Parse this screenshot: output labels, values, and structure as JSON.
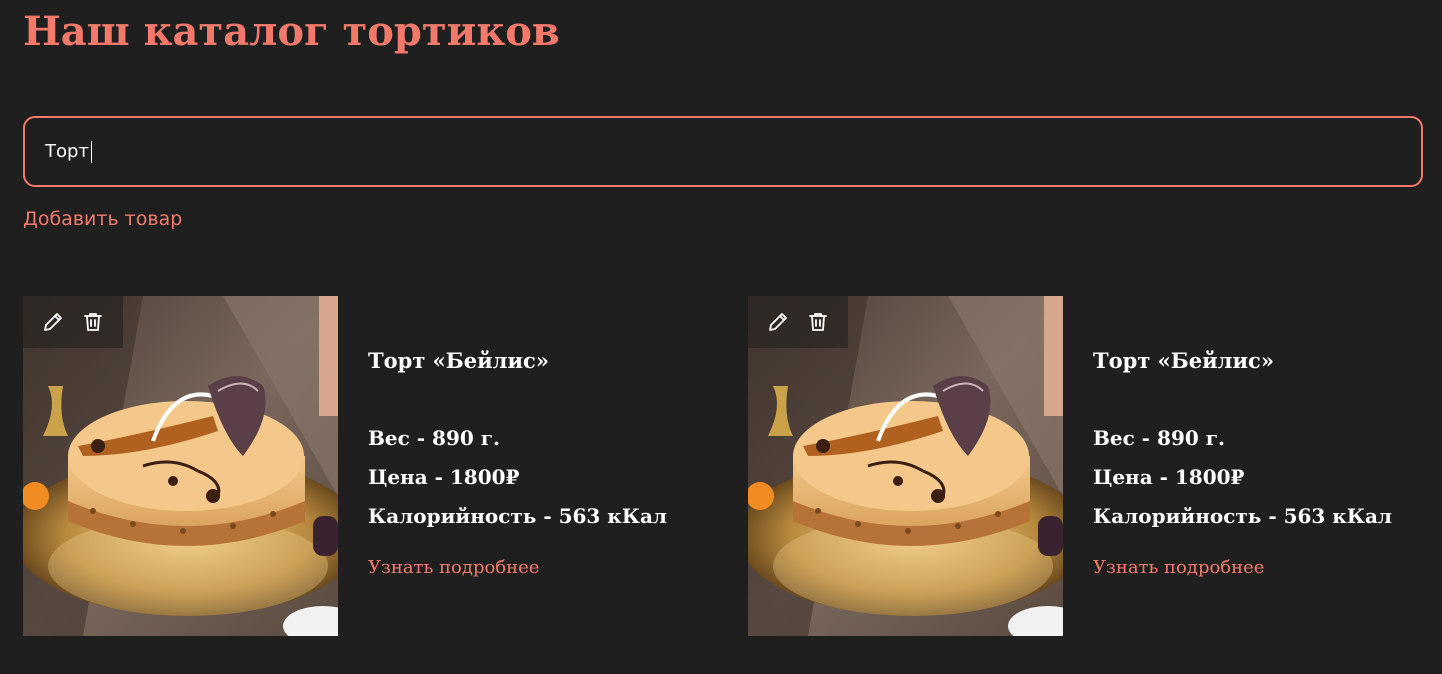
{
  "page": {
    "title": "Наш каталог тортиков"
  },
  "search": {
    "value": "Торт"
  },
  "actions": {
    "add_label": "Добавить товар"
  },
  "colors": {
    "accent": "#f37a6b",
    "background": "#1f1f1f",
    "text": "#ffffff"
  },
  "products": [
    {
      "title": "Торт «Бейлис»",
      "weight": "Вес - 890 г.",
      "price": "Цена - 1800₽",
      "calories": "Калорийность - 563 кКал",
      "more_label": "Узнать подробнее",
      "icons": [
        "pencil-icon",
        "trash-icon"
      ]
    },
    {
      "title": "Торт «Бейлис»",
      "weight": "Вес - 890 г.",
      "price": "Цена - 1800₽",
      "calories": "Калорийность - 563 кКал",
      "more_label": "Узнать подробнее",
      "icons": [
        "pencil-icon",
        "trash-icon"
      ]
    }
  ]
}
